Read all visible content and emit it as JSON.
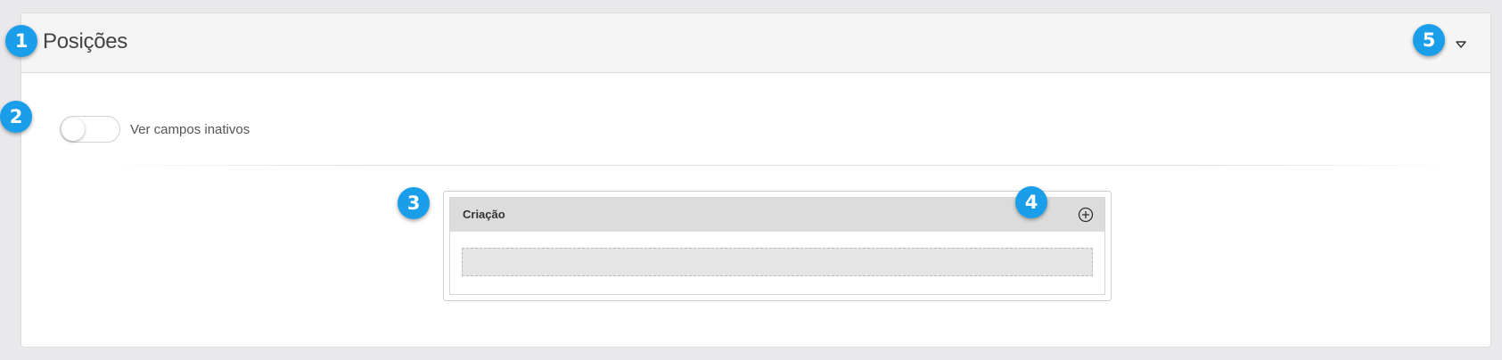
{
  "panel": {
    "title": "Posições"
  },
  "filters": {
    "toggle_label": "Ver campos inativos",
    "show_inactive": false
  },
  "card": {
    "title": "Criação"
  },
  "badges": [
    "1",
    "2",
    "3",
    "4",
    "5"
  ],
  "icons": {
    "collapse": "caret-down-icon",
    "add": "plus-circle-icon"
  },
  "colors": {
    "badge": "#1a9eea",
    "header_bg": "#f5f5f5",
    "card_header_bg": "#dcdcdc",
    "page_bg": "#e9e9ec"
  }
}
